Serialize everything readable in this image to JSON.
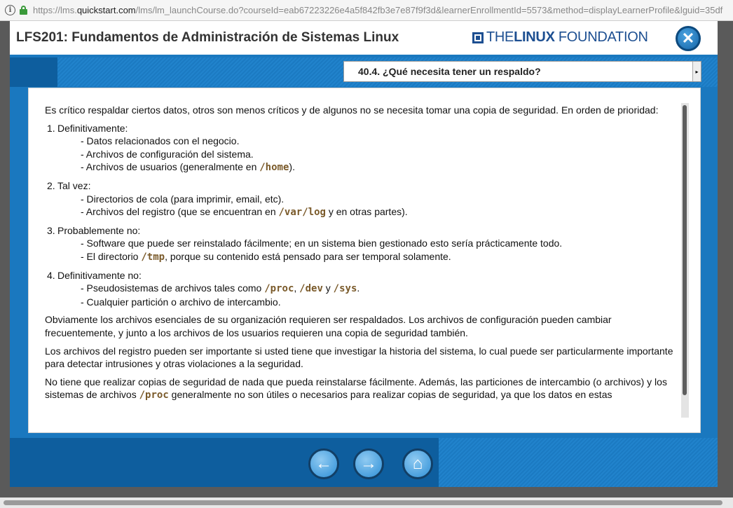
{
  "browser": {
    "url_prefix": "https://lms.",
    "url_host": "quickstart.com",
    "url_rest": "/lms/lm_launchCourse.do?courseId=eab67223226e4a5f842fb3e7e87f9f3d&learnerEnrollmentId=5573&method=displayLearnerProfile&lguid=35df"
  },
  "header": {
    "course_title": "LFS201: Fundamentos de Administración de Sistemas Linux",
    "logo_the": "THE",
    "logo_linux": "LINUX",
    "logo_foundation": " FOUNDATION",
    "close_glyph": "✕"
  },
  "section_select": {
    "selected": "40.4. ¿Qué necesita tener un respaldo?",
    "arrow": "▸"
  },
  "content": {
    "intro": "Es crítico respaldar ciertos datos, otros son menos críticos y de algunos no se necesita tomar una copia de seguridad. En orden de prioridad:",
    "items": [
      {
        "num": "1.",
        "title": "Definitivamente:",
        "lines": [
          "- Datos relacionados con el negocio.",
          "- Archivos de configuración del sistema."
        ],
        "line3_pre": "- Archivos de usuarios (generalmente en ",
        "line3_code": "/home",
        "line3_post": ")."
      },
      {
        "num": "2.",
        "title": "Tal vez:",
        "line1": "- Directorios de cola (para imprimir, email, etc).",
        "line2_pre": "- Archivos del registro (que se encuentran en ",
        "line2_code": "/var/log",
        "line2_post": " y en otras partes)."
      },
      {
        "num": "3.",
        "title": "Probablemente no:",
        "line1": "- Software que puede ser reinstalado fácilmente; en un sistema bien gestionado esto sería prácticamente todo.",
        "line2_pre": "- El directorio ",
        "line2_code": "/tmp",
        "line2_post": ", porque su contenido está pensado para ser temporal solamente."
      },
      {
        "num": "4.",
        "title": "Definitivamente no:",
        "line1_pre": "- Pseudosistemas de archivos tales como ",
        "code_proc": "/proc",
        "sep1": ", ",
        "code_dev": "/dev",
        "sep2": " y ",
        "code_sys": "/sys",
        "line1_post": ".",
        "line2": "- Cualquier partición o archivo de intercambio."
      }
    ],
    "para1": "Obviamente los archivos esenciales de su organización requieren ser respaldados. Los archivos de configuración pueden cambiar frecuentemente, y junto a los archivos de los usuarios requieren una copia de seguridad también.",
    "para2": "Los archivos del registro pueden ser importante si usted tiene que investigar la historia del sistema, lo cual puede ser particularmente importante para detectar intrusiones y otras violaciones a la seguridad.",
    "para3_pre": "No tiene que realizar copias de seguridad de nada que pueda reinstalarse fácilmente. Además, las particiones de intercambio (o archivos) y los sistemas de archivos ",
    "para3_code": "/proc",
    "para3_post": " generalmente no son útiles o necesarios para realizar copias de seguridad, ya que los datos en estas"
  },
  "nav": {
    "back_glyph": "←",
    "next_glyph": "→",
    "home_glyph": "⌂"
  }
}
